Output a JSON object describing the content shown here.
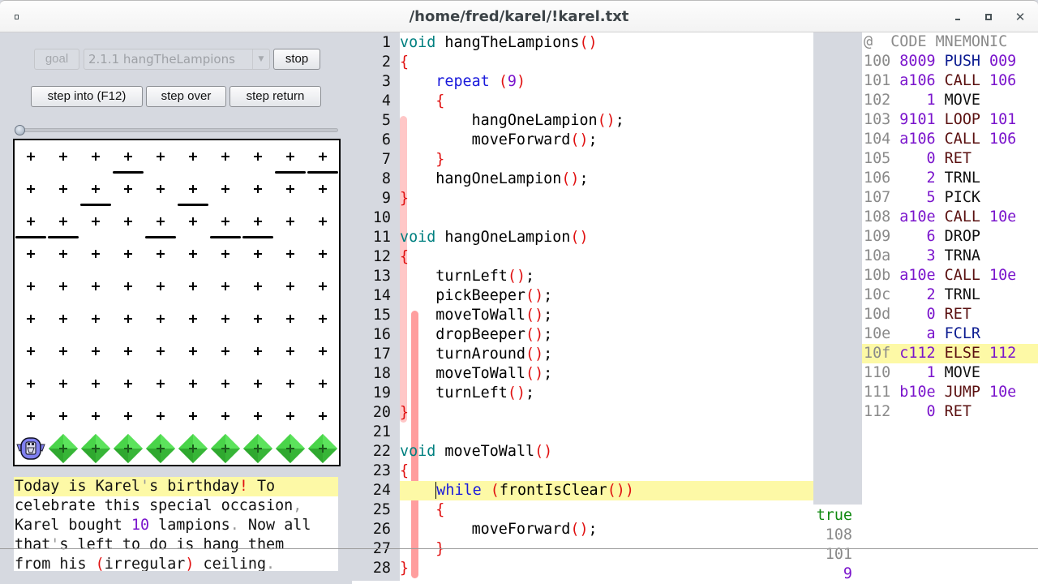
{
  "window": {
    "title": "/home/fred/karel/!karel.txt",
    "minimize_label": "_",
    "maximize_label": "□",
    "close_label": "✕"
  },
  "controls": {
    "goal_label": "goal",
    "problem_selected": "2.1.1 hangTheLampions",
    "stop_label": "stop",
    "step_into_label": "step into (F12)",
    "step_over_label": "step over",
    "step_return_label": "step return",
    "speed_slider_value": 0
  },
  "world": {
    "columns": 10,
    "rows": 10,
    "walls_below": [
      {
        "row": 0,
        "cols": [
          3,
          8,
          9
        ]
      },
      {
        "row": 1,
        "cols": [
          2,
          5
        ]
      },
      {
        "row": 2,
        "cols": [
          0,
          1,
          4,
          6,
          7
        ]
      }
    ],
    "karel": {
      "row": 9,
      "col": 0,
      "facing": "east"
    },
    "beepers": [
      {
        "row": 9,
        "col": 1
      },
      {
        "row": 9,
        "col": 2
      },
      {
        "row": 9,
        "col": 3
      },
      {
        "row": 9,
        "col": 4
      },
      {
        "row": 9,
        "col": 5
      },
      {
        "row": 9,
        "col": 6
      },
      {
        "row": 9,
        "col": 7
      },
      {
        "row": 9,
        "col": 8
      },
      {
        "row": 9,
        "col": 9
      }
    ],
    "colors": {
      "beeper": "#3ec93e",
      "karel": "#8080f0",
      "wall": "#000000"
    }
  },
  "story": {
    "lines": [
      [
        {
          "t": "Today is Karel"
        },
        {
          "t": "'",
          "c": "dim"
        },
        {
          "t": "s birthday"
        },
        {
          "t": "!",
          "c": "punc"
        },
        {
          "t": " To"
        }
      ],
      [
        {
          "t": "celebrate this special occasion"
        },
        {
          "t": ",",
          "c": "dim"
        }
      ],
      [
        {
          "t": "Karel bought "
        },
        {
          "t": "10",
          "c": "num"
        },
        {
          "t": " lampions"
        },
        {
          "t": ".",
          "c": "dim"
        },
        {
          "t": " Now all"
        }
      ],
      [
        {
          "t": "that"
        },
        {
          "t": "'",
          "c": "dim"
        },
        {
          "t": "s left to do is hang them"
        }
      ],
      [
        {
          "t": "from his "
        },
        {
          "t": "(",
          "c": "punc"
        },
        {
          "t": "irregular"
        },
        {
          "t": ")",
          "c": "punc"
        },
        {
          "t": " ceiling"
        },
        {
          "t": ".",
          "c": "dim"
        }
      ]
    ],
    "highlighted_line": 0
  },
  "editor": {
    "current_line": 24,
    "lines": [
      [
        {
          "t": "void",
          "c": "kw-void"
        },
        {
          "t": " hangTheLampions"
        },
        {
          "t": "()",
          "c": "punc"
        }
      ],
      [
        {
          "t": "{",
          "c": "punc"
        }
      ],
      [
        {
          "t": "    "
        },
        {
          "t": "repeat",
          "c": "kw"
        },
        {
          "t": " "
        },
        {
          "t": "(",
          "c": "punc"
        },
        {
          "t": "9",
          "c": "num"
        },
        {
          "t": ")",
          "c": "punc"
        }
      ],
      [
        {
          "t": "    "
        },
        {
          "t": "{",
          "c": "punc"
        }
      ],
      [
        {
          "t": "        hangOneLampion"
        },
        {
          "t": "()",
          "c": "punc"
        },
        {
          "t": ";"
        }
      ],
      [
        {
          "t": "        moveForward"
        },
        {
          "t": "()",
          "c": "punc"
        },
        {
          "t": ";"
        }
      ],
      [
        {
          "t": "    "
        },
        {
          "t": "}",
          "c": "punc"
        }
      ],
      [
        {
          "t": "    hangOneLampion"
        },
        {
          "t": "()",
          "c": "punc"
        },
        {
          "t": ";"
        }
      ],
      [
        {
          "t": "}",
          "c": "punc"
        }
      ],
      [],
      [
        {
          "t": "void",
          "c": "kw-void"
        },
        {
          "t": " hangOneLampion"
        },
        {
          "t": "()",
          "c": "punc"
        }
      ],
      [
        {
          "t": "{",
          "c": "punc"
        }
      ],
      [
        {
          "t": "    turnLeft"
        },
        {
          "t": "()",
          "c": "punc"
        },
        {
          "t": ";"
        }
      ],
      [
        {
          "t": "    pickBeeper"
        },
        {
          "t": "()",
          "c": "punc"
        },
        {
          "t": ";"
        }
      ],
      [
        {
          "t": "    moveToWall"
        },
        {
          "t": "()",
          "c": "punc"
        },
        {
          "t": ";"
        }
      ],
      [
        {
          "t": "    dropBeeper"
        },
        {
          "t": "()",
          "c": "punc"
        },
        {
          "t": ";"
        }
      ],
      [
        {
          "t": "    turnAround"
        },
        {
          "t": "()",
          "c": "punc"
        },
        {
          "t": ";"
        }
      ],
      [
        {
          "t": "    moveToWall"
        },
        {
          "t": "()",
          "c": "punc"
        },
        {
          "t": ";"
        }
      ],
      [
        {
          "t": "    turnLeft"
        },
        {
          "t": "()",
          "c": "punc"
        },
        {
          "t": ";"
        }
      ],
      [
        {
          "t": "}",
          "c": "punc"
        }
      ],
      [],
      [
        {
          "t": "void",
          "c": "kw-void"
        },
        {
          "t": " moveToWall"
        },
        {
          "t": "()",
          "c": "punc"
        }
      ],
      [
        {
          "t": "{",
          "c": "punc"
        }
      ],
      [
        {
          "t": "    "
        },
        {
          "t": "while",
          "c": "kw"
        },
        {
          "t": " "
        },
        {
          "t": "(",
          "c": "punc"
        },
        {
          "t": "frontIsClear"
        },
        {
          "t": "())",
          "c": "punc"
        }
      ],
      [
        {
          "t": "    "
        },
        {
          "t": "{",
          "c": "punc"
        }
      ],
      [
        {
          "t": "        moveForward"
        },
        {
          "t": "()",
          "c": "punc"
        },
        {
          "t": ";"
        }
      ],
      [
        {
          "t": "    "
        },
        {
          "t": "}",
          "c": "punc"
        }
      ],
      [
        {
          "t": "}",
          "c": "punc"
        }
      ]
    ],
    "call_stack_frames": [
      {
        "from_line": 5,
        "to_line": 20,
        "color": "#ffc4c4"
      },
      {
        "from_line": 15,
        "to_line": 28,
        "color": "#ff9494"
      }
    ]
  },
  "assembly": {
    "header": {
      "addr": "@",
      "code": "CODE",
      "mnemonic": "MNEMONIC"
    },
    "current_addr": "10f",
    "rows": [
      {
        "addr": "100",
        "code": "8009",
        "op": "PUSH",
        "arg": "009",
        "kind": "push"
      },
      {
        "addr": "101",
        "code": "a106",
        "op": "CALL",
        "arg": "106",
        "kind": "call"
      },
      {
        "addr": "102",
        "code": "1",
        "op": "MOVE",
        "arg": "",
        "kind": "plain"
      },
      {
        "addr": "103",
        "code": "9101",
        "op": "LOOP",
        "arg": "101",
        "kind": "call"
      },
      {
        "addr": "104",
        "code": "a106",
        "op": "CALL",
        "arg": "106",
        "kind": "call"
      },
      {
        "addr": "105",
        "code": "0",
        "op": "RET",
        "arg": "",
        "kind": "call"
      },
      {
        "addr": "106",
        "code": "2",
        "op": "TRNL",
        "arg": "",
        "kind": "plain"
      },
      {
        "addr": "107",
        "code": "5",
        "op": "PICK",
        "arg": "",
        "kind": "plain"
      },
      {
        "addr": "108",
        "code": "a10e",
        "op": "CALL",
        "arg": "10e",
        "kind": "call"
      },
      {
        "addr": "109",
        "code": "6",
        "op": "DROP",
        "arg": "",
        "kind": "plain"
      },
      {
        "addr": "10a",
        "code": "3",
        "op": "TRNA",
        "arg": "",
        "kind": "plain"
      },
      {
        "addr": "10b",
        "code": "a10e",
        "op": "CALL",
        "arg": "10e",
        "kind": "call"
      },
      {
        "addr": "10c",
        "code": "2",
        "op": "TRNL",
        "arg": "",
        "kind": "plain"
      },
      {
        "addr": "10d",
        "code": "0",
        "op": "RET",
        "arg": "",
        "kind": "call"
      },
      {
        "addr": "10e",
        "code": "a",
        "op": "FCLR",
        "arg": "",
        "kind": "push"
      },
      {
        "addr": "10f",
        "code": "c112",
        "op": "ELSE",
        "arg": "112",
        "kind": "call"
      },
      {
        "addr": "110",
        "code": "1",
        "op": "MOVE",
        "arg": "",
        "kind": "plain"
      },
      {
        "addr": "111",
        "code": "b10e",
        "op": "JUMP",
        "arg": "10e",
        "kind": "call"
      },
      {
        "addr": "112",
        "code": "0",
        "op": "RET",
        "arg": "",
        "kind": "call"
      }
    ]
  },
  "stack_values": [
    {
      "value": "true",
      "kind": "true"
    },
    {
      "value": "108",
      "kind": "addr"
    },
    {
      "value": "101",
      "kind": "addr"
    },
    {
      "value": "9",
      "kind": "num"
    }
  ]
}
